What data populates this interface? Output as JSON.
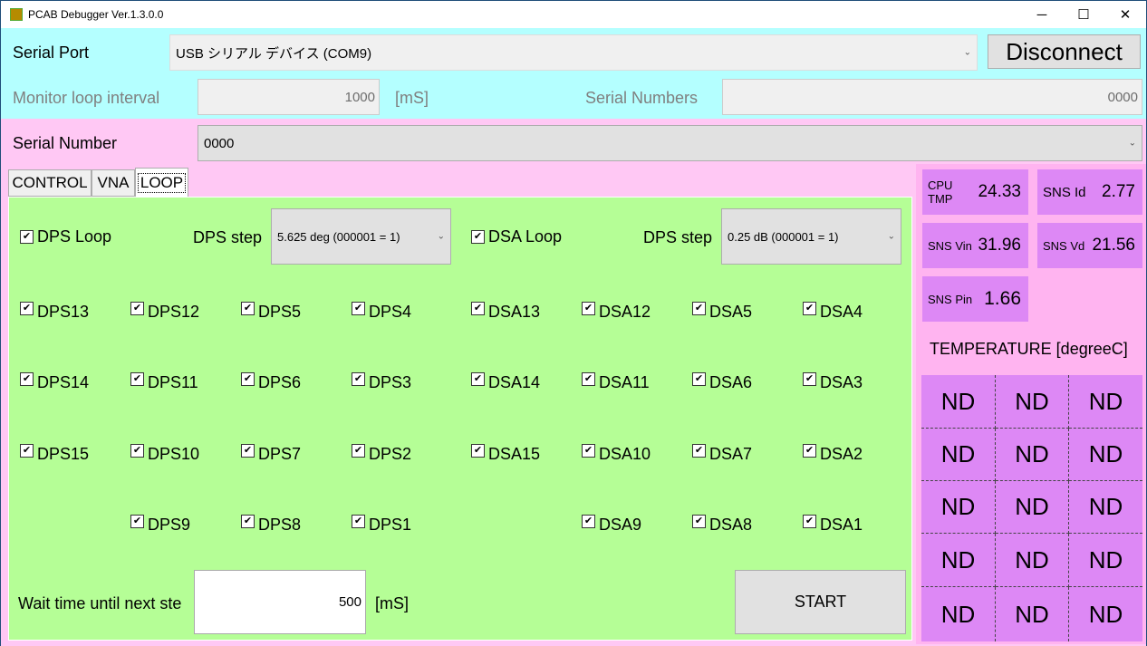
{
  "window": {
    "title": "PCAB Debugger Ver.1.3.0.0",
    "min": "─",
    "max": "☐",
    "close": "✕"
  },
  "serial_port": {
    "label": "Serial Port",
    "value": "USB シリアル デバイス (COM9)",
    "button": "Disconnect"
  },
  "monitor": {
    "label": "Monitor loop interval",
    "value": "1000",
    "unit": "[mS]",
    "sn_label": "Serial Numbers",
    "sn_value": "0000"
  },
  "serial_number": {
    "label": "Serial Number",
    "value": "0000"
  },
  "tabs": [
    "CONTROL",
    "VNA",
    "LOOP"
  ],
  "loop": {
    "dps_loop": "DPS Loop",
    "dps_step_label": "DPS step",
    "dps_step_value": "5.625 deg (000001 = 1)",
    "dsa_loop": "DSA Loop",
    "dsa_step_label": "DPS step",
    "dsa_step_value": "0.25 dB (000001 = 1)",
    "check_mark": "✔",
    "rows": [
      [
        "DPS13",
        "DPS12",
        "DPS5",
        "DPS4",
        "DSA13",
        "DSA12",
        "DSA5",
        "DSA4"
      ],
      [
        "DPS14",
        "DPS11",
        "DPS6",
        "DPS3",
        "DSA14",
        "DSA11",
        "DSA6",
        "DSA3"
      ],
      [
        "DPS15",
        "DPS10",
        "DPS7",
        "DPS2",
        "DSA15",
        "DSA10",
        "DSA7",
        "DSA2"
      ],
      [
        "",
        "DPS9",
        "DPS8",
        "DPS1",
        "",
        "DSA9",
        "DSA8",
        "DSA1"
      ]
    ],
    "wait_label": "Wait time until next ste",
    "wait_value": "500",
    "wait_unit": "[mS]",
    "start": "START"
  },
  "sensors": {
    "cpu_tmp": {
      "label": "CPU TMP",
      "value": "24.33"
    },
    "sns_id": {
      "label": "SNS Id",
      "value": "2.77"
    },
    "sns_vin": {
      "label": "SNS Vin",
      "value": "31.96"
    },
    "sns_vd": {
      "label": "SNS Vd",
      "value": "21.56"
    },
    "sns_pin": {
      "label": "SNS Pin",
      "value": "1.66"
    }
  },
  "temperature": {
    "label": "TEMPERATURE [degreeC]",
    "cells": [
      "ND",
      "ND",
      "ND",
      "ND",
      "ND",
      "ND",
      "ND",
      "ND",
      "ND",
      "ND",
      "ND",
      "ND",
      "ND",
      "ND",
      "ND"
    ]
  },
  "colors": {
    "cyan": "#b4ffff",
    "pink": "#ffc8f4",
    "green": "#b5fe96",
    "violet": "#dd88f5"
  }
}
